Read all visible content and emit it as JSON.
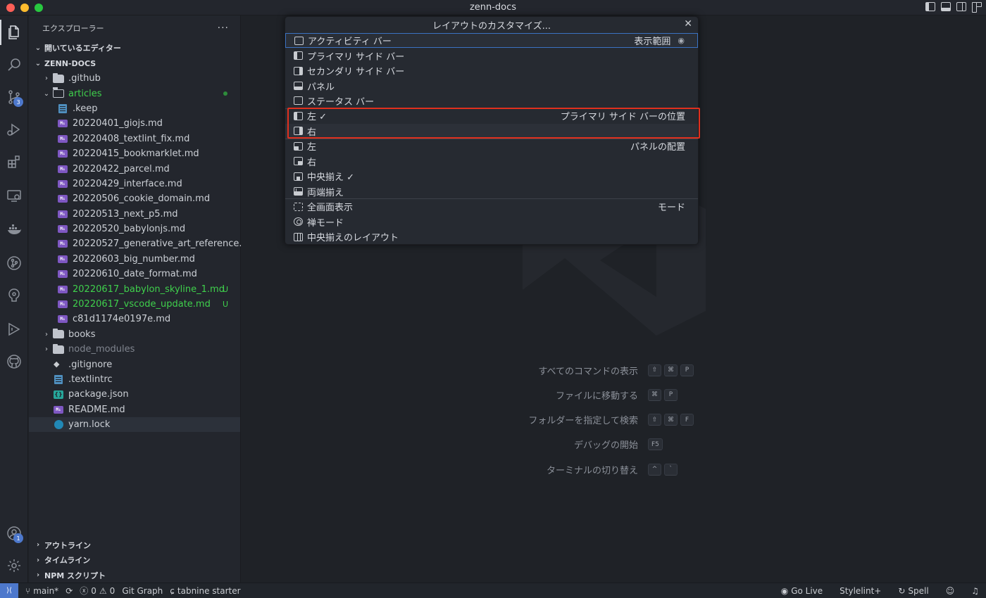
{
  "window": {
    "title": "zenn-docs"
  },
  "activity_bar": {
    "items": [
      {
        "name": "explorer-icon"
      },
      {
        "name": "search-icon"
      },
      {
        "name": "source-control-icon",
        "badge": "3"
      },
      {
        "name": "run-debug-icon"
      },
      {
        "name": "extensions-icon"
      },
      {
        "name": "remote-explorer-icon"
      },
      {
        "name": "docker-icon"
      },
      {
        "name": "git-graph-icon"
      },
      {
        "name": "gitlens-icon"
      },
      {
        "name": "live-share-icon"
      },
      {
        "name": "github-icon"
      }
    ],
    "accounts_badge": "1"
  },
  "sidebar": {
    "header": "エクスプローラー",
    "open_editors": "開いているエディター",
    "project": "ZENN-DOCS",
    "tree": [
      {
        "label": ".github",
        "type": "folder",
        "indent": 1
      },
      {
        "label": "articles",
        "type": "folder-open",
        "indent": 1,
        "status": "green"
      },
      {
        "label": ".keep",
        "type": "txt",
        "indent": 2
      },
      {
        "label": "20220401_giojs.md",
        "type": "md",
        "indent": 2
      },
      {
        "label": "20220408_textlint_fix.md",
        "type": "md",
        "indent": 2
      },
      {
        "label": "20220415_bookmarklet.md",
        "type": "md",
        "indent": 2
      },
      {
        "label": "20220422_parcel.md",
        "type": "md",
        "indent": 2
      },
      {
        "label": "20220429_interface.md",
        "type": "md",
        "indent": 2
      },
      {
        "label": "20220506_cookie_domain.md",
        "type": "md",
        "indent": 2
      },
      {
        "label": "20220513_next_p5.md",
        "type": "md",
        "indent": 2
      },
      {
        "label": "20220520_babylonjs.md",
        "type": "md",
        "indent": 2
      },
      {
        "label": "20220527_generative_art_reference....",
        "type": "md",
        "indent": 2
      },
      {
        "label": "20220603_big_number.md",
        "type": "md",
        "indent": 2
      },
      {
        "label": "20220610_date_format.md",
        "type": "md",
        "indent": 2
      },
      {
        "label": "20220617_babylon_skyline_1.md",
        "type": "md",
        "indent": 2,
        "status": "U"
      },
      {
        "label": "20220617_vscode_update.md",
        "type": "md",
        "indent": 2,
        "status": "U"
      },
      {
        "label": "c81d1174e0197e.md",
        "type": "md",
        "indent": 2
      },
      {
        "label": "books",
        "type": "folder",
        "indent": 1
      },
      {
        "label": "node_modules",
        "type": "folder",
        "indent": 1,
        "dim": true
      },
      {
        "label": ".gitignore",
        "type": "git",
        "indent": 1
      },
      {
        "label": ".textlintrc",
        "type": "txt",
        "indent": 1
      },
      {
        "label": "package.json",
        "type": "json",
        "indent": 1
      },
      {
        "label": "README.md",
        "type": "md",
        "indent": 1
      },
      {
        "label": "yarn.lock",
        "type": "yarn",
        "indent": 1,
        "selected": true
      }
    ],
    "outline": "アウトライン",
    "timeline": "タイムライン",
    "npm_scripts": "NPM スクリプト"
  },
  "quick_pick": {
    "title": "レイアウトのカスタマイズ...",
    "rows": [
      {
        "label": "アクティビティ バー",
        "icon": "box",
        "right": "表示範囲",
        "eye": true,
        "focused": true
      },
      {
        "label": "プライマリ サイド バー",
        "icon": "left"
      },
      {
        "label": "セカンダリ サイド バー",
        "icon": "right"
      },
      {
        "label": "パネル",
        "icon": "bottom"
      },
      {
        "label": "ステータス バー",
        "icon": "box"
      },
      {
        "label": "左 ✓",
        "icon": "left",
        "right": "プライマリ サイド バーの位置",
        "sep": true
      },
      {
        "label": "右",
        "icon": "right",
        "hovered": true
      },
      {
        "label": "左",
        "icon": "bl",
        "right": "パネルの配置",
        "sep": true
      },
      {
        "label": "右",
        "icon": "br"
      },
      {
        "label": "中央揃え ✓",
        "icon": "bc"
      },
      {
        "label": "両端揃え",
        "icon": "bj"
      },
      {
        "label": "全画面表示",
        "icon": "full",
        "right": "モード",
        "sep": true
      },
      {
        "label": "禅モード",
        "icon": "zen"
      },
      {
        "label": "中央揃えのレイアウト",
        "icon": "center"
      }
    ],
    "eye_glyph": "◉"
  },
  "shortcuts": [
    {
      "label": "すべてのコマンドの表示",
      "keys": [
        "⇧",
        "⌘",
        "P"
      ]
    },
    {
      "label": "ファイルに移動する",
      "keys": [
        "⌘",
        "P"
      ]
    },
    {
      "label": "フォルダーを指定して検索",
      "keys": [
        "⇧",
        "⌘",
        "F"
      ]
    },
    {
      "label": "デバッグの開始",
      "keys": [
        "F5"
      ]
    },
    {
      "label": "ターミナルの切り替え",
      "keys": [
        "^",
        "`"
      ]
    }
  ],
  "status_bar": {
    "branch": "main*",
    "errors": "0",
    "warnings": "0",
    "git_graph": "Git Graph",
    "tabnine": "tabnine starter",
    "go_live": "Go Live",
    "stylelint": "Stylelint+",
    "spell": "Spell"
  }
}
